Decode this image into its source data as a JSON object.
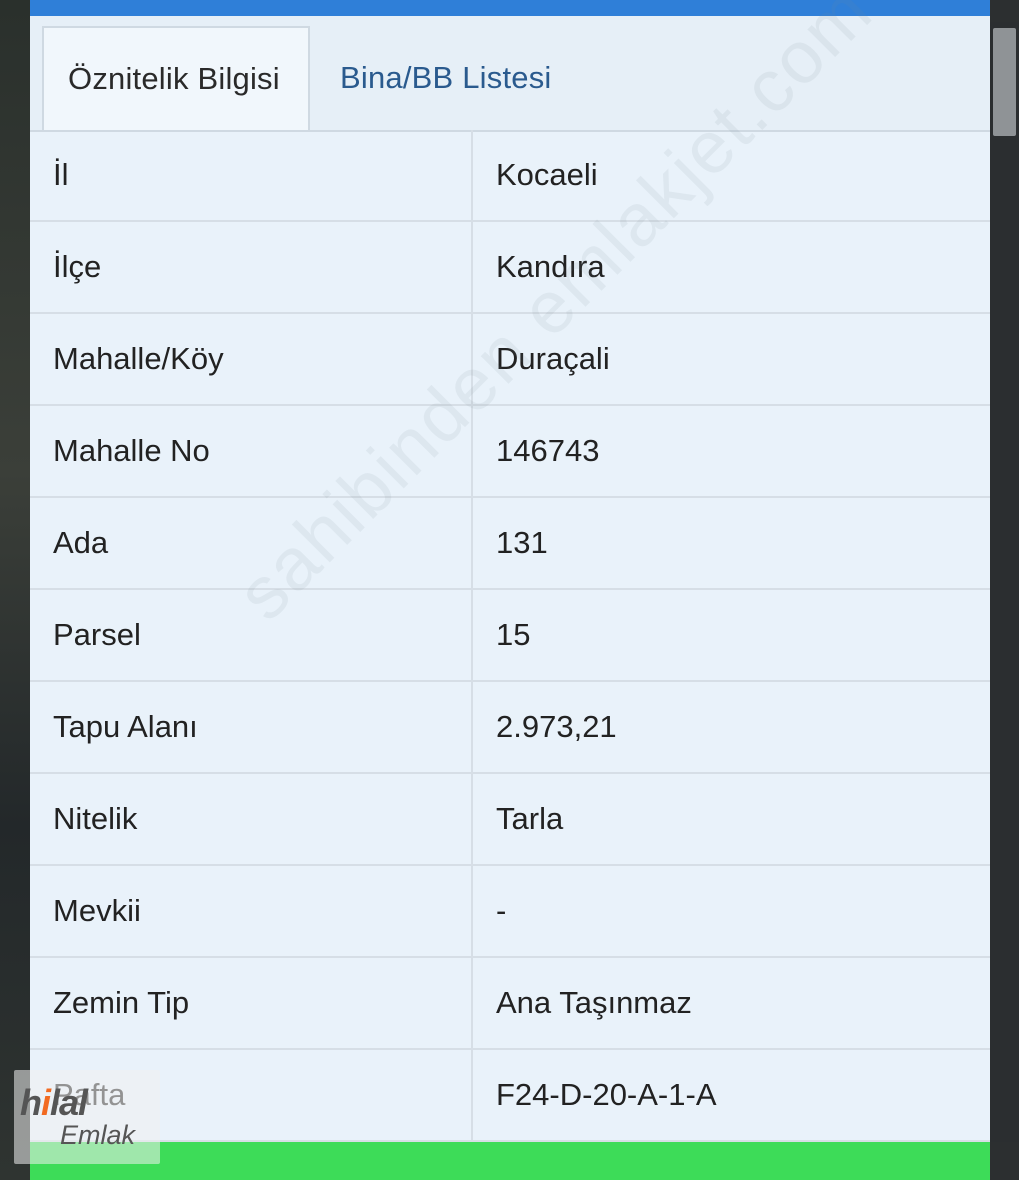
{
  "tabs": [
    {
      "label": "Öznitelik Bilgisi",
      "active": true
    },
    {
      "label": "Bina/BB Listesi",
      "active": false
    }
  ],
  "rows": [
    {
      "label": "İl",
      "value": "Kocaeli"
    },
    {
      "label": "İlçe",
      "value": "Kandıra"
    },
    {
      "label": "Mahalle/Köy",
      "value": "Duraçali"
    },
    {
      "label": "Mahalle No",
      "value": "146743"
    },
    {
      "label": "Ada",
      "value": "131"
    },
    {
      "label": "Parsel",
      "value": "15"
    },
    {
      "label": "Tapu Alanı",
      "value": "2.973,21"
    },
    {
      "label": "Nitelik",
      "value": "Tarla"
    },
    {
      "label": "Mevkii",
      "value": "-"
    },
    {
      "label": "Zemin Tip",
      "value": "Ana Taşınmaz"
    },
    {
      "label": "Pafta",
      "value": "F24-D-20-A-1-A"
    }
  ],
  "watermark": {
    "text": "sahibinden emlakjet.com"
  },
  "logo": {
    "brand_prefix": "h",
    "brand_dot": "i",
    "brand_suffix": "lal",
    "sub": "Emlak"
  },
  "colors": {
    "top_bar": "#2f7fd8",
    "panel_bg": "#e9f2fa",
    "tab_link": "#2a5a8e",
    "bottom_bar": "#3ddc58",
    "logo_accent": "#f26a21"
  }
}
